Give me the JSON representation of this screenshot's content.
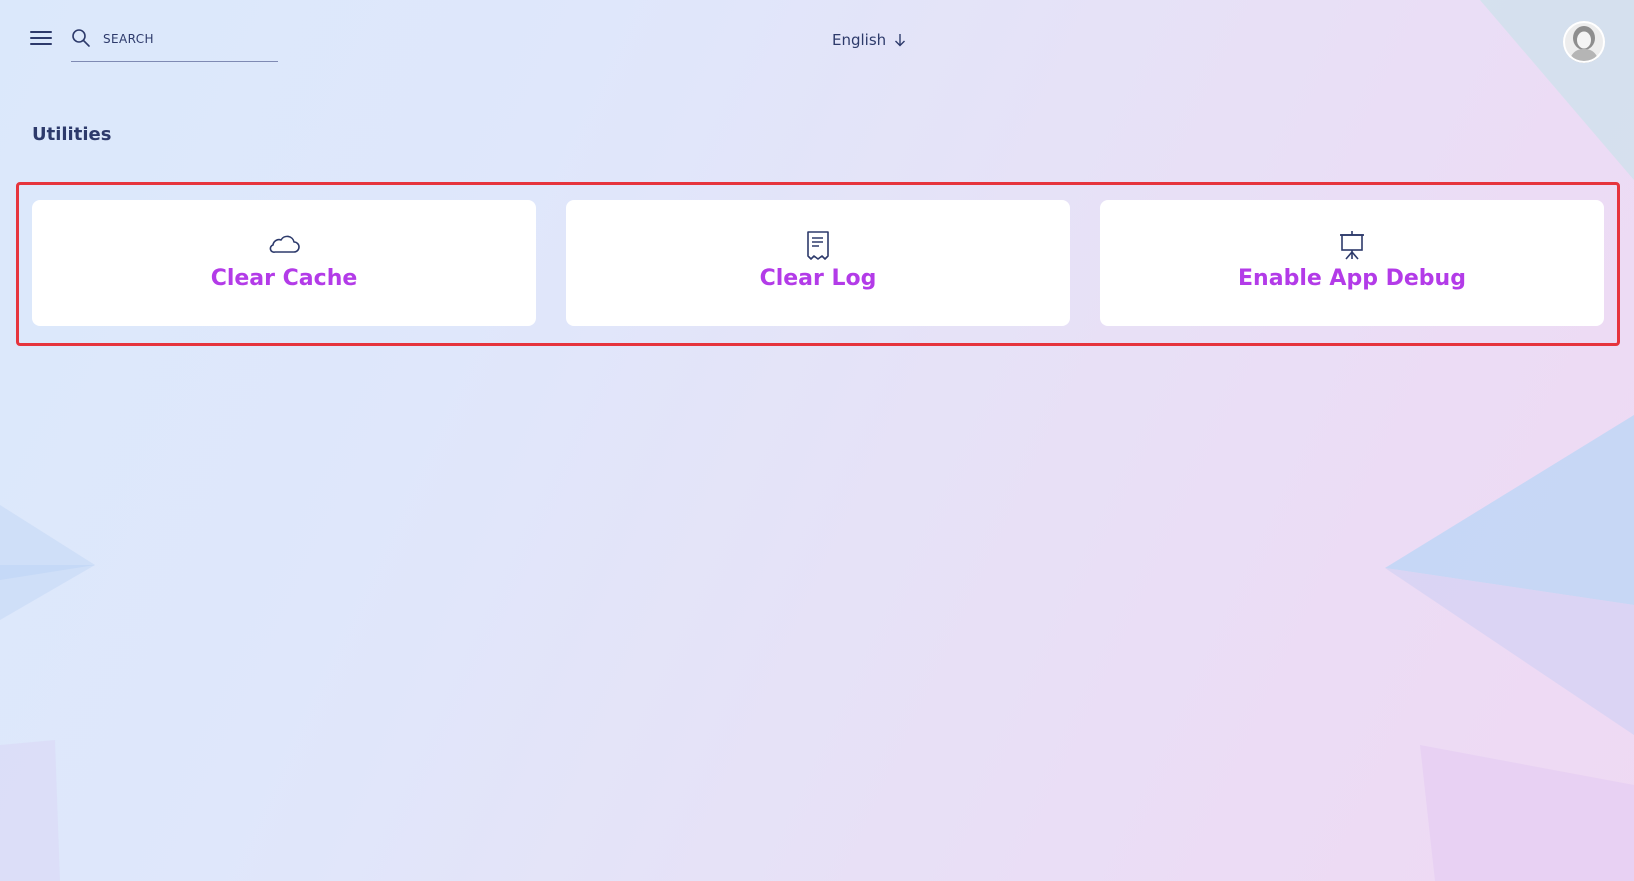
{
  "header": {
    "search_placeholder": "SEARCH",
    "search_value": "",
    "language": "English"
  },
  "page": {
    "title": "Utilities"
  },
  "utilities": [
    {
      "label": "Clear Cache",
      "icon": "cloud-icon"
    },
    {
      "label": "Clear Log",
      "icon": "receipt-icon"
    },
    {
      "label": "Enable App Debug",
      "icon": "presentation-board-icon"
    }
  ],
  "colors": {
    "accent": "#b33be8",
    "text": "#2d3a6b",
    "highlight": "#e6343d",
    "card": "#ffffff"
  }
}
